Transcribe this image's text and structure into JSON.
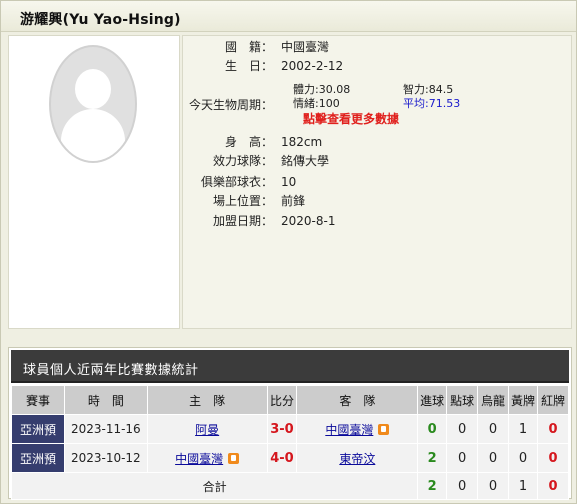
{
  "player": {
    "name": "游耀興(Yu Yao-Hsing)"
  },
  "avatar": {
    "icon": "person-silhouette-icon"
  },
  "info": {
    "nationality_label": "國　籍：",
    "nationality": "中國臺灣",
    "birth_label": "生　日：",
    "birth": "2002-2-12",
    "bio_label": "今天生物周期：",
    "bio": {
      "physical_label": "體力:",
      "physical": "30.08",
      "intellect_label": "智力:",
      "intellect": "84.5",
      "emotion_label": "情緒:",
      "emotion": "100",
      "average_label": "平均:",
      "average": "71.53",
      "more_link": "點擊查看更多數據"
    },
    "height_label": "身　高：",
    "height": "182cm",
    "team_label": "效力球隊：",
    "team": "銘傳大學",
    "shirt_label": "俱樂部球衣：",
    "shirt": "10",
    "position_label": "場上位置：",
    "position": "前鋒",
    "join_label": "加盟日期：",
    "join": "2020-8-1"
  },
  "stats": {
    "title": "球員個人近兩年比賽數據統計",
    "headers": [
      "賽事",
      "時　間",
      "主　隊",
      "比分",
      "客　隊",
      "進球",
      "點球",
      "烏龍",
      "黃牌",
      "紅牌"
    ],
    "rows": [
      {
        "event": "亞洲預",
        "date": "2023-11-16",
        "home": "阿曼",
        "home_flag": false,
        "score": "3-0",
        "away": "中國臺灣",
        "away_flag": true,
        "goals": "0",
        "penalty": "0",
        "own_goal": "0",
        "yellow": "1",
        "red": "0"
      },
      {
        "event": "亞洲預",
        "date": "2023-10-12",
        "home": "中國臺灣",
        "home_flag": true,
        "score": "4-0",
        "away": "東帝汶",
        "away_flag": false,
        "goals": "2",
        "penalty": "0",
        "own_goal": "0",
        "yellow": "0",
        "red": "0"
      }
    ],
    "total": {
      "label": "合計",
      "goals": "2",
      "penalty": "0",
      "own_goal": "0",
      "yellow": "1",
      "red": "0"
    }
  },
  "colors": {
    "event_cell": "#353d6e",
    "score": "#d5161d",
    "goals": "#2a8a1e",
    "link": "#0a0a9a",
    "bio_link": "#e0201d"
  }
}
